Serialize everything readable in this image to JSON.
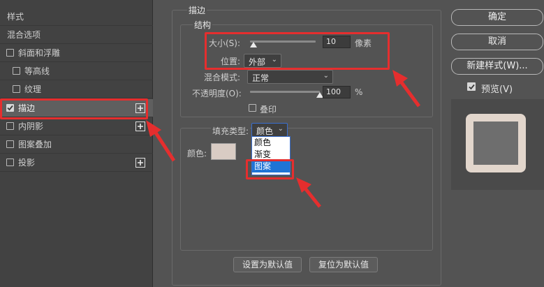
{
  "left_panel": {
    "items": [
      {
        "label": "样式"
      },
      {
        "label": "混合选项"
      },
      {
        "label": "斜面和浮雕"
      },
      {
        "label": "等高线"
      },
      {
        "label": "纹理"
      },
      {
        "label": "描边"
      },
      {
        "label": "内阴影"
      },
      {
        "label": "图案叠加"
      },
      {
        "label": "投影"
      }
    ]
  },
  "stroke": {
    "section_title": "描边",
    "structure_title": "结构",
    "size_label": "大小(S):",
    "size_value": "10",
    "size_unit": "像素",
    "size_slider_fraction": 0.05,
    "position_label": "位置:",
    "position_value": "外部",
    "blend_label": "混合模式:",
    "blend_value": "正常",
    "opacity_label": "不透明度(O):",
    "opacity_value": "100",
    "opacity_unit": "%",
    "opacity_slider_fraction": 1.0,
    "overprint_label": "叠印",
    "fill_type_label": "填充类型:",
    "fill_type_value": "颜色",
    "color_label": "颜色:",
    "fill_options": [
      "颜色",
      "渐变",
      "图案"
    ],
    "swatch_color": "#d9ccc4",
    "set_default": "设置为默认值",
    "reset_default": "复位为默认值"
  },
  "right": {
    "ok": "确定",
    "cancel": "取消",
    "new_style": "新建样式(W)...",
    "preview": "预览(V)",
    "preview_outer": "#e2d6cc",
    "preview_inner": "#6e6e6e"
  },
  "colors": {
    "highlight": "#e52e2e",
    "selection_blue": "#1f74d6"
  }
}
